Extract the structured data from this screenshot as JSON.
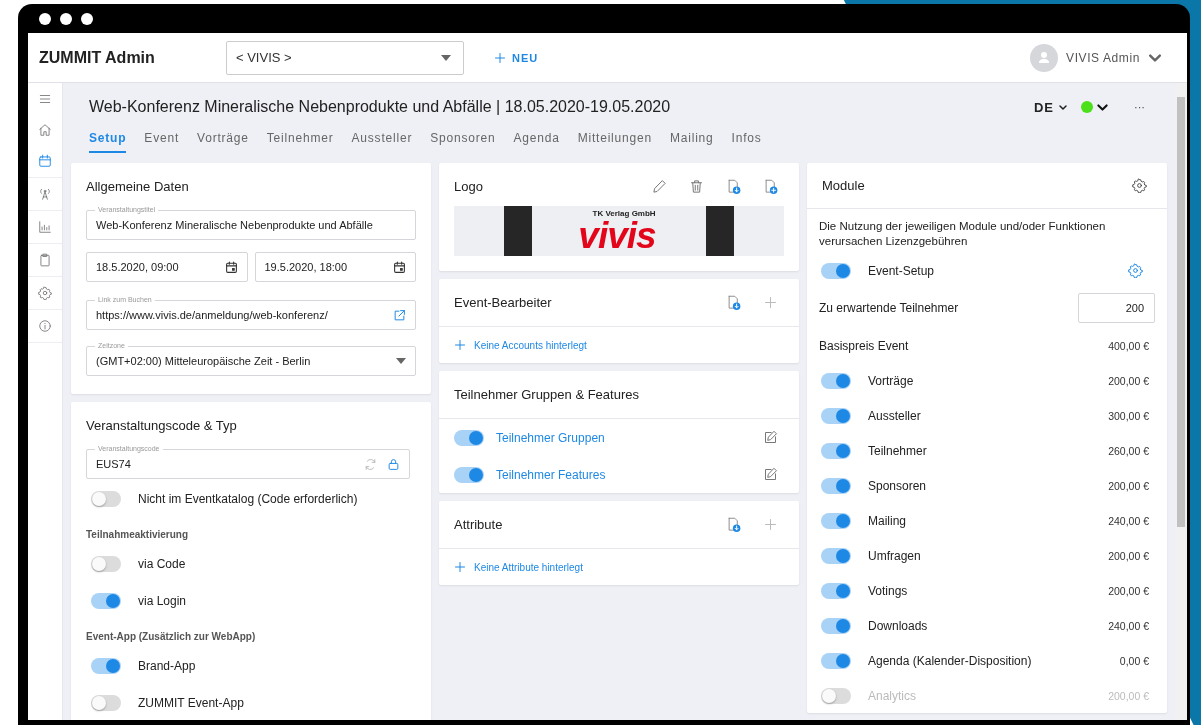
{
  "app_header": {
    "title": "ZUMMIT Admin",
    "event_select": {
      "value": "< VIVIS >"
    },
    "new_button": "NEU",
    "user": {
      "name": "VIVIS Admin"
    }
  },
  "sidebar": {
    "items": [
      {
        "selected": false
      },
      {
        "selected": false
      },
      {
        "selected": true
      },
      {
        "selected": false
      },
      {
        "selected": false
      },
      {
        "selected": false
      },
      {
        "selected": false
      },
      {
        "selected": false
      }
    ]
  },
  "page": {
    "title": "Web-Konferenz Mineralische Nebenprodukte und Abfälle | 18.05.2020-19.05.2020",
    "language": "DE",
    "more": "···"
  },
  "tabs": [
    {
      "label": "Setup",
      "selected": true
    },
    {
      "label": "Event",
      "selected": false
    },
    {
      "label": "Vorträge",
      "selected": false
    },
    {
      "label": "Teilnehmer",
      "selected": false
    },
    {
      "label": "Aussteller",
      "selected": false
    },
    {
      "label": "Sponsoren",
      "selected": false
    },
    {
      "label": "Agenda",
      "selected": false
    },
    {
      "label": "Mitteilungen",
      "selected": false
    },
    {
      "label": "Mailing",
      "selected": false
    },
    {
      "label": "Infos",
      "selected": false
    }
  ],
  "general": {
    "title": "Allgemeine Daten",
    "event_title": {
      "label": "Veranstaltungstitel",
      "value": "Web-Konferenz Mineralische Nebenprodukte und Abfälle"
    },
    "start": {
      "value": "18.5.2020, 09:00"
    },
    "end": {
      "value": "19.5.2020, 18:00"
    },
    "booking_link": {
      "label": "Link zum Buchen",
      "value": "https://www.vivis.de/anmeldung/web-konferenz/"
    },
    "timezone": {
      "label": "Zeitzone",
      "value": "(GMT+02:00) Mitteleuropäische Zeit - Berlin"
    }
  },
  "code_card": {
    "title": "Veranstaltungscode & Typ",
    "code": {
      "label": "Veranstaltungscode",
      "value": "EUS74"
    },
    "catalog": {
      "label": "Nicht im Eventkatalog (Code erforderlich)",
      "on": false
    },
    "activation": {
      "heading": "Teilnahmeaktivierung",
      "options": [
        {
          "label": "via Code",
          "on": false
        },
        {
          "label": "via Login",
          "on": true
        }
      ]
    },
    "event_app": {
      "heading": "Event-App (Zusätzlich zur WebApp)",
      "options": [
        {
          "label": "Brand-App",
          "on": true
        },
        {
          "label": "ZUMMIT Event-App",
          "on": false
        }
      ]
    }
  },
  "logo_card": {
    "title": "Logo",
    "logo": {
      "tagline": "TK Verlag GmbH",
      "wordmark": "vivis"
    }
  },
  "editors_card": {
    "title": "Event-Bearbeiter",
    "empty": "Keine Accounts hinterlegt"
  },
  "groups_card": {
    "title": "Teilnehmer Gruppen & Features",
    "items": [
      {
        "label": "Teilnehmer Gruppen",
        "on": true
      },
      {
        "label": "Teilnehmer Features",
        "on": true
      }
    ]
  },
  "attributes_card": {
    "title": "Attribute",
    "empty": "Keine Attribute hinterlegt"
  },
  "modules_card": {
    "title": "Module",
    "note": "Die Nutzung der jeweiligen Module und/oder Funktionen verursachen Lizenzgebühren",
    "event_setup": {
      "label": "Event-Setup",
      "on": true
    },
    "expected": {
      "label": "Zu erwartende Teilnehmer",
      "value": "200"
    },
    "base": {
      "label": "Basispreis Event",
      "price": "400,00 €"
    },
    "modules": [
      {
        "label": "Vorträge",
        "price": "200,00 €",
        "on": true
      },
      {
        "label": "Aussteller",
        "price": "300,00 €",
        "on": true
      },
      {
        "label": "Teilnehmer",
        "price": "260,00 €",
        "on": true
      },
      {
        "label": "Sponsoren",
        "price": "200,00 €",
        "on": true
      },
      {
        "label": "Mailing",
        "price": "240,00 €",
        "on": true
      },
      {
        "label": "Umfragen",
        "price": "200,00 €",
        "on": true
      },
      {
        "label": "Votings",
        "price": "200,00 €",
        "on": true
      },
      {
        "label": "Downloads",
        "price": "240,00 €",
        "on": true
      },
      {
        "label": "Agenda (Kalender-Disposition)",
        "price": "0,00 €",
        "on": true
      },
      {
        "label": "Analytics",
        "price": "200,00 €",
        "on": false
      }
    ]
  }
}
